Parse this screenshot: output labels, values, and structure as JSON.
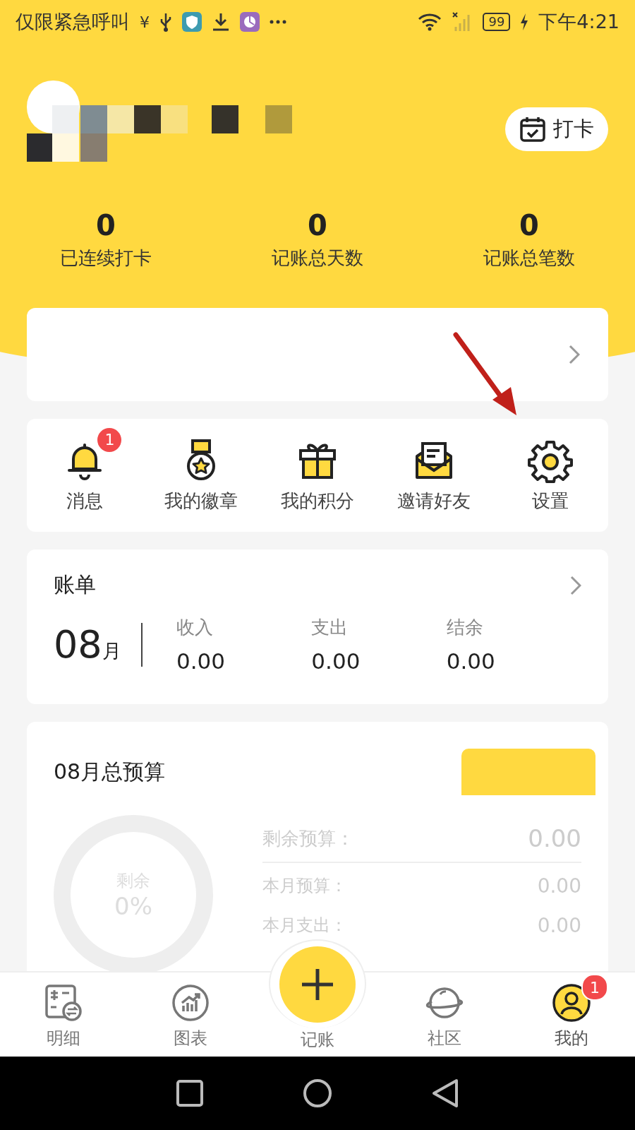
{
  "status_bar": {
    "carrier": "仅限紧急呼叫",
    "yuan_glyph": "¥",
    "battery": "99",
    "time": "下午4:21"
  },
  "checkin_button": {
    "label": "打卡"
  },
  "stats": [
    {
      "value": "0",
      "label": "已连续打卡"
    },
    {
      "value": "0",
      "label": "记账总天数"
    },
    {
      "value": "0",
      "label": "记账总笔数"
    }
  ],
  "shortcuts": [
    {
      "kind": "bell",
      "label": "消息",
      "badge": "1"
    },
    {
      "kind": "medal",
      "label": "我的徽章"
    },
    {
      "kind": "gift",
      "label": "我的积分"
    },
    {
      "kind": "mail",
      "label": "邀请好友"
    },
    {
      "kind": "gear",
      "label": "设置"
    }
  ],
  "bill": {
    "title": "账单",
    "month": "08",
    "month_unit": "月",
    "columns": [
      {
        "label": "收入",
        "value": "0.00"
      },
      {
        "label": "支出",
        "value": "0.00"
      },
      {
        "label": "结余",
        "value": "0.00"
      }
    ]
  },
  "budget": {
    "title": "08月总预算",
    "ring_label": "剩余",
    "ring_value": "0%",
    "rows": [
      {
        "label": "剩余预算：",
        "value": "0.00"
      },
      {
        "label": "本月预算：",
        "value": "0.00"
      },
      {
        "label": "本月支出：",
        "value": "0.00"
      }
    ]
  },
  "tab_bar": [
    {
      "kind": "list",
      "label": "明细",
      "selected": false
    },
    {
      "kind": "chart",
      "label": "图表",
      "selected": false
    },
    {
      "kind": "add",
      "label": "记账",
      "selected": false
    },
    {
      "kind": "planet",
      "label": "社区",
      "selected": false
    },
    {
      "kind": "user",
      "label": "我的",
      "selected": true,
      "badge": "1"
    }
  ]
}
